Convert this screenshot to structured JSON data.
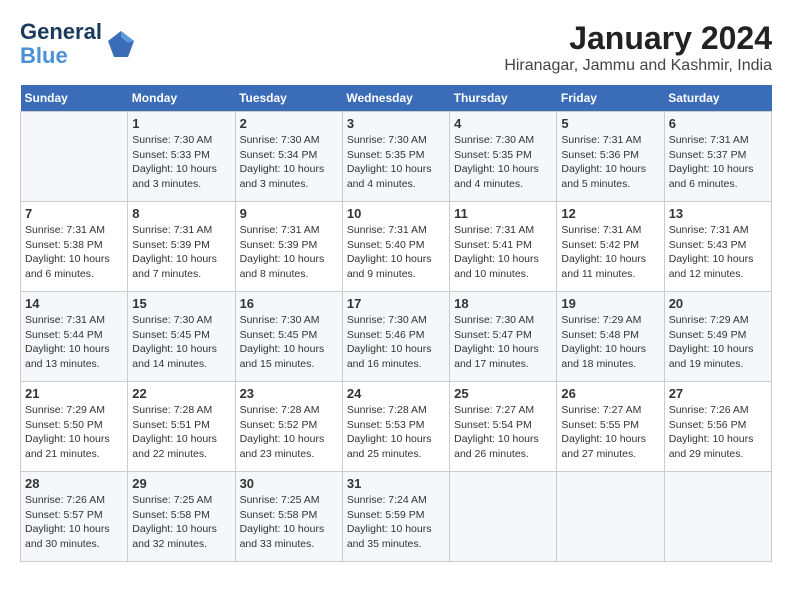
{
  "logo": {
    "line1": "General",
    "line2": "Blue"
  },
  "title": "January 2024",
  "subtitle": "Hiranagar, Jammu and Kashmir, India",
  "headers": [
    "Sunday",
    "Monday",
    "Tuesday",
    "Wednesday",
    "Thursday",
    "Friday",
    "Saturday"
  ],
  "weeks": [
    [
      {
        "day": "",
        "sunrise": "",
        "sunset": "",
        "daylight": ""
      },
      {
        "day": "1",
        "sunrise": "Sunrise: 7:30 AM",
        "sunset": "Sunset: 5:33 PM",
        "daylight": "Daylight: 10 hours and 3 minutes."
      },
      {
        "day": "2",
        "sunrise": "Sunrise: 7:30 AM",
        "sunset": "Sunset: 5:34 PM",
        "daylight": "Daylight: 10 hours and 3 minutes."
      },
      {
        "day": "3",
        "sunrise": "Sunrise: 7:30 AM",
        "sunset": "Sunset: 5:35 PM",
        "daylight": "Daylight: 10 hours and 4 minutes."
      },
      {
        "day": "4",
        "sunrise": "Sunrise: 7:30 AM",
        "sunset": "Sunset: 5:35 PM",
        "daylight": "Daylight: 10 hours and 4 minutes."
      },
      {
        "day": "5",
        "sunrise": "Sunrise: 7:31 AM",
        "sunset": "Sunset: 5:36 PM",
        "daylight": "Daylight: 10 hours and 5 minutes."
      },
      {
        "day": "6",
        "sunrise": "Sunrise: 7:31 AM",
        "sunset": "Sunset: 5:37 PM",
        "daylight": "Daylight: 10 hours and 6 minutes."
      }
    ],
    [
      {
        "day": "7",
        "sunrise": "Sunrise: 7:31 AM",
        "sunset": "Sunset: 5:38 PM",
        "daylight": "Daylight: 10 hours and 6 minutes."
      },
      {
        "day": "8",
        "sunrise": "Sunrise: 7:31 AM",
        "sunset": "Sunset: 5:39 PM",
        "daylight": "Daylight: 10 hours and 7 minutes."
      },
      {
        "day": "9",
        "sunrise": "Sunrise: 7:31 AM",
        "sunset": "Sunset: 5:39 PM",
        "daylight": "Daylight: 10 hours and 8 minutes."
      },
      {
        "day": "10",
        "sunrise": "Sunrise: 7:31 AM",
        "sunset": "Sunset: 5:40 PM",
        "daylight": "Daylight: 10 hours and 9 minutes."
      },
      {
        "day": "11",
        "sunrise": "Sunrise: 7:31 AM",
        "sunset": "Sunset: 5:41 PM",
        "daylight": "Daylight: 10 hours and 10 minutes."
      },
      {
        "day": "12",
        "sunrise": "Sunrise: 7:31 AM",
        "sunset": "Sunset: 5:42 PM",
        "daylight": "Daylight: 10 hours and 11 minutes."
      },
      {
        "day": "13",
        "sunrise": "Sunrise: 7:31 AM",
        "sunset": "Sunset: 5:43 PM",
        "daylight": "Daylight: 10 hours and 12 minutes."
      }
    ],
    [
      {
        "day": "14",
        "sunrise": "Sunrise: 7:31 AM",
        "sunset": "Sunset: 5:44 PM",
        "daylight": "Daylight: 10 hours and 13 minutes."
      },
      {
        "day": "15",
        "sunrise": "Sunrise: 7:30 AM",
        "sunset": "Sunset: 5:45 PM",
        "daylight": "Daylight: 10 hours and 14 minutes."
      },
      {
        "day": "16",
        "sunrise": "Sunrise: 7:30 AM",
        "sunset": "Sunset: 5:45 PM",
        "daylight": "Daylight: 10 hours and 15 minutes."
      },
      {
        "day": "17",
        "sunrise": "Sunrise: 7:30 AM",
        "sunset": "Sunset: 5:46 PM",
        "daylight": "Daylight: 10 hours and 16 minutes."
      },
      {
        "day": "18",
        "sunrise": "Sunrise: 7:30 AM",
        "sunset": "Sunset: 5:47 PM",
        "daylight": "Daylight: 10 hours and 17 minutes."
      },
      {
        "day": "19",
        "sunrise": "Sunrise: 7:29 AM",
        "sunset": "Sunset: 5:48 PM",
        "daylight": "Daylight: 10 hours and 18 minutes."
      },
      {
        "day": "20",
        "sunrise": "Sunrise: 7:29 AM",
        "sunset": "Sunset: 5:49 PM",
        "daylight": "Daylight: 10 hours and 19 minutes."
      }
    ],
    [
      {
        "day": "21",
        "sunrise": "Sunrise: 7:29 AM",
        "sunset": "Sunset: 5:50 PM",
        "daylight": "Daylight: 10 hours and 21 minutes."
      },
      {
        "day": "22",
        "sunrise": "Sunrise: 7:28 AM",
        "sunset": "Sunset: 5:51 PM",
        "daylight": "Daylight: 10 hours and 22 minutes."
      },
      {
        "day": "23",
        "sunrise": "Sunrise: 7:28 AM",
        "sunset": "Sunset: 5:52 PM",
        "daylight": "Daylight: 10 hours and 23 minutes."
      },
      {
        "day": "24",
        "sunrise": "Sunrise: 7:28 AM",
        "sunset": "Sunset: 5:53 PM",
        "daylight": "Daylight: 10 hours and 25 minutes."
      },
      {
        "day": "25",
        "sunrise": "Sunrise: 7:27 AM",
        "sunset": "Sunset: 5:54 PM",
        "daylight": "Daylight: 10 hours and 26 minutes."
      },
      {
        "day": "26",
        "sunrise": "Sunrise: 7:27 AM",
        "sunset": "Sunset: 5:55 PM",
        "daylight": "Daylight: 10 hours and 27 minutes."
      },
      {
        "day": "27",
        "sunrise": "Sunrise: 7:26 AM",
        "sunset": "Sunset: 5:56 PM",
        "daylight": "Daylight: 10 hours and 29 minutes."
      }
    ],
    [
      {
        "day": "28",
        "sunrise": "Sunrise: 7:26 AM",
        "sunset": "Sunset: 5:57 PM",
        "daylight": "Daylight: 10 hours and 30 minutes."
      },
      {
        "day": "29",
        "sunrise": "Sunrise: 7:25 AM",
        "sunset": "Sunset: 5:58 PM",
        "daylight": "Daylight: 10 hours and 32 minutes."
      },
      {
        "day": "30",
        "sunrise": "Sunrise: 7:25 AM",
        "sunset": "Sunset: 5:58 PM",
        "daylight": "Daylight: 10 hours and 33 minutes."
      },
      {
        "day": "31",
        "sunrise": "Sunrise: 7:24 AM",
        "sunset": "Sunset: 5:59 PM",
        "daylight": "Daylight: 10 hours and 35 minutes."
      },
      {
        "day": "",
        "sunrise": "",
        "sunset": "",
        "daylight": ""
      },
      {
        "day": "",
        "sunrise": "",
        "sunset": "",
        "daylight": ""
      },
      {
        "day": "",
        "sunrise": "",
        "sunset": "",
        "daylight": ""
      }
    ]
  ]
}
